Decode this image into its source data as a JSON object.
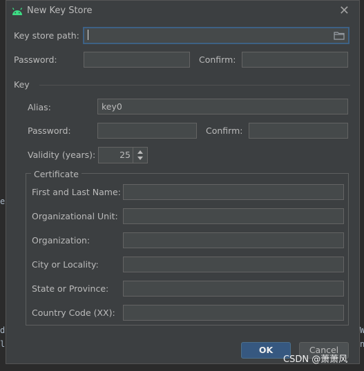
{
  "window": {
    "title": "New Key Store"
  },
  "keystore": {
    "path_label": "Key store path:",
    "path_value": "",
    "password_label": "Password:",
    "password_value": "",
    "confirm_label": "Confirm:",
    "confirm_value": ""
  },
  "key": {
    "section_label": "Key",
    "alias_label": "Alias:",
    "alias_value": "key0",
    "password_label": "Password:",
    "password_value": "",
    "confirm_label": "Confirm:",
    "confirm_value": "",
    "validity_label": "Validity (years):",
    "validity_value": "25"
  },
  "certificate": {
    "section_label": "Certificate",
    "fields": [
      {
        "label": "First and Last Name:",
        "value": ""
      },
      {
        "label": "Organizational Unit:",
        "value": ""
      },
      {
        "label": "Organization:",
        "value": ""
      },
      {
        "label": "City or Locality:",
        "value": ""
      },
      {
        "label": "State or Province:",
        "value": ""
      },
      {
        "label": "Country Code (XX):",
        "value": ""
      }
    ]
  },
  "buttons": {
    "ok": "OK",
    "cancel": "Cancel"
  },
  "watermark": "CSDN @萧萧风",
  "background": {
    "left_chars": [
      "e",
      "d",
      "l"
    ],
    "right_chars": [
      "W",
      "n"
    ]
  },
  "colors": {
    "accent": "#365880",
    "focus_border": "#3d6185",
    "android_green": "#3ddc84"
  }
}
